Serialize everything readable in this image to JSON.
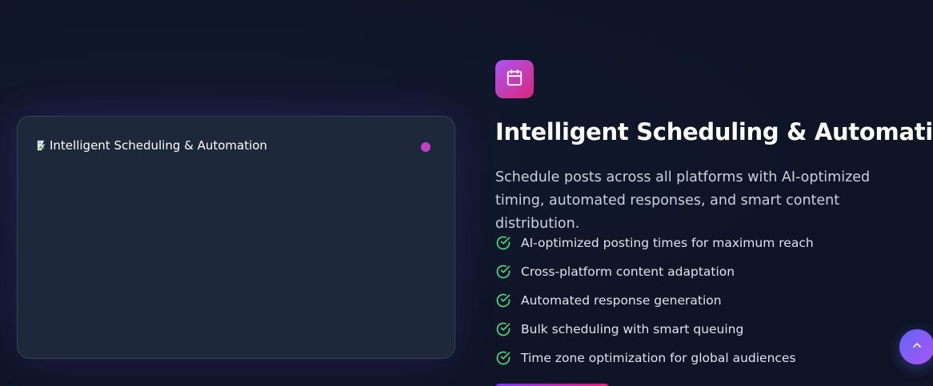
{
  "feature": {
    "icon": "calendar-icon",
    "title": "Intelligent Scheduling & Automation",
    "description": "Schedule posts across all platforms with AI-optimized timing, automated responses, and smart content distribution.",
    "image_alt": "Intelligent Scheduling & Automation",
    "items": [
      {
        "label": "AI-optimized posting times for maximum reach",
        "icon": "check-circle-icon"
      },
      {
        "label": "Cross-platform content adaptation",
        "icon": "check-circle-icon"
      },
      {
        "label": "Automated response generation",
        "icon": "check-circle-icon"
      },
      {
        "label": "Bulk scheduling with smart queuing",
        "icon": "check-circle-icon"
      },
      {
        "label": "Time zone optimization for global audiences",
        "icon": "check-circle-icon"
      }
    ]
  },
  "scroll_top": {
    "icon": "chevron-up-icon"
  },
  "colors": {
    "background": "#0f1527",
    "card": "#1e283b",
    "accent_gradient_start": "#a855f7",
    "accent_gradient_end": "#db2777",
    "check": "#4ade80",
    "dot": "#c13fc4"
  }
}
